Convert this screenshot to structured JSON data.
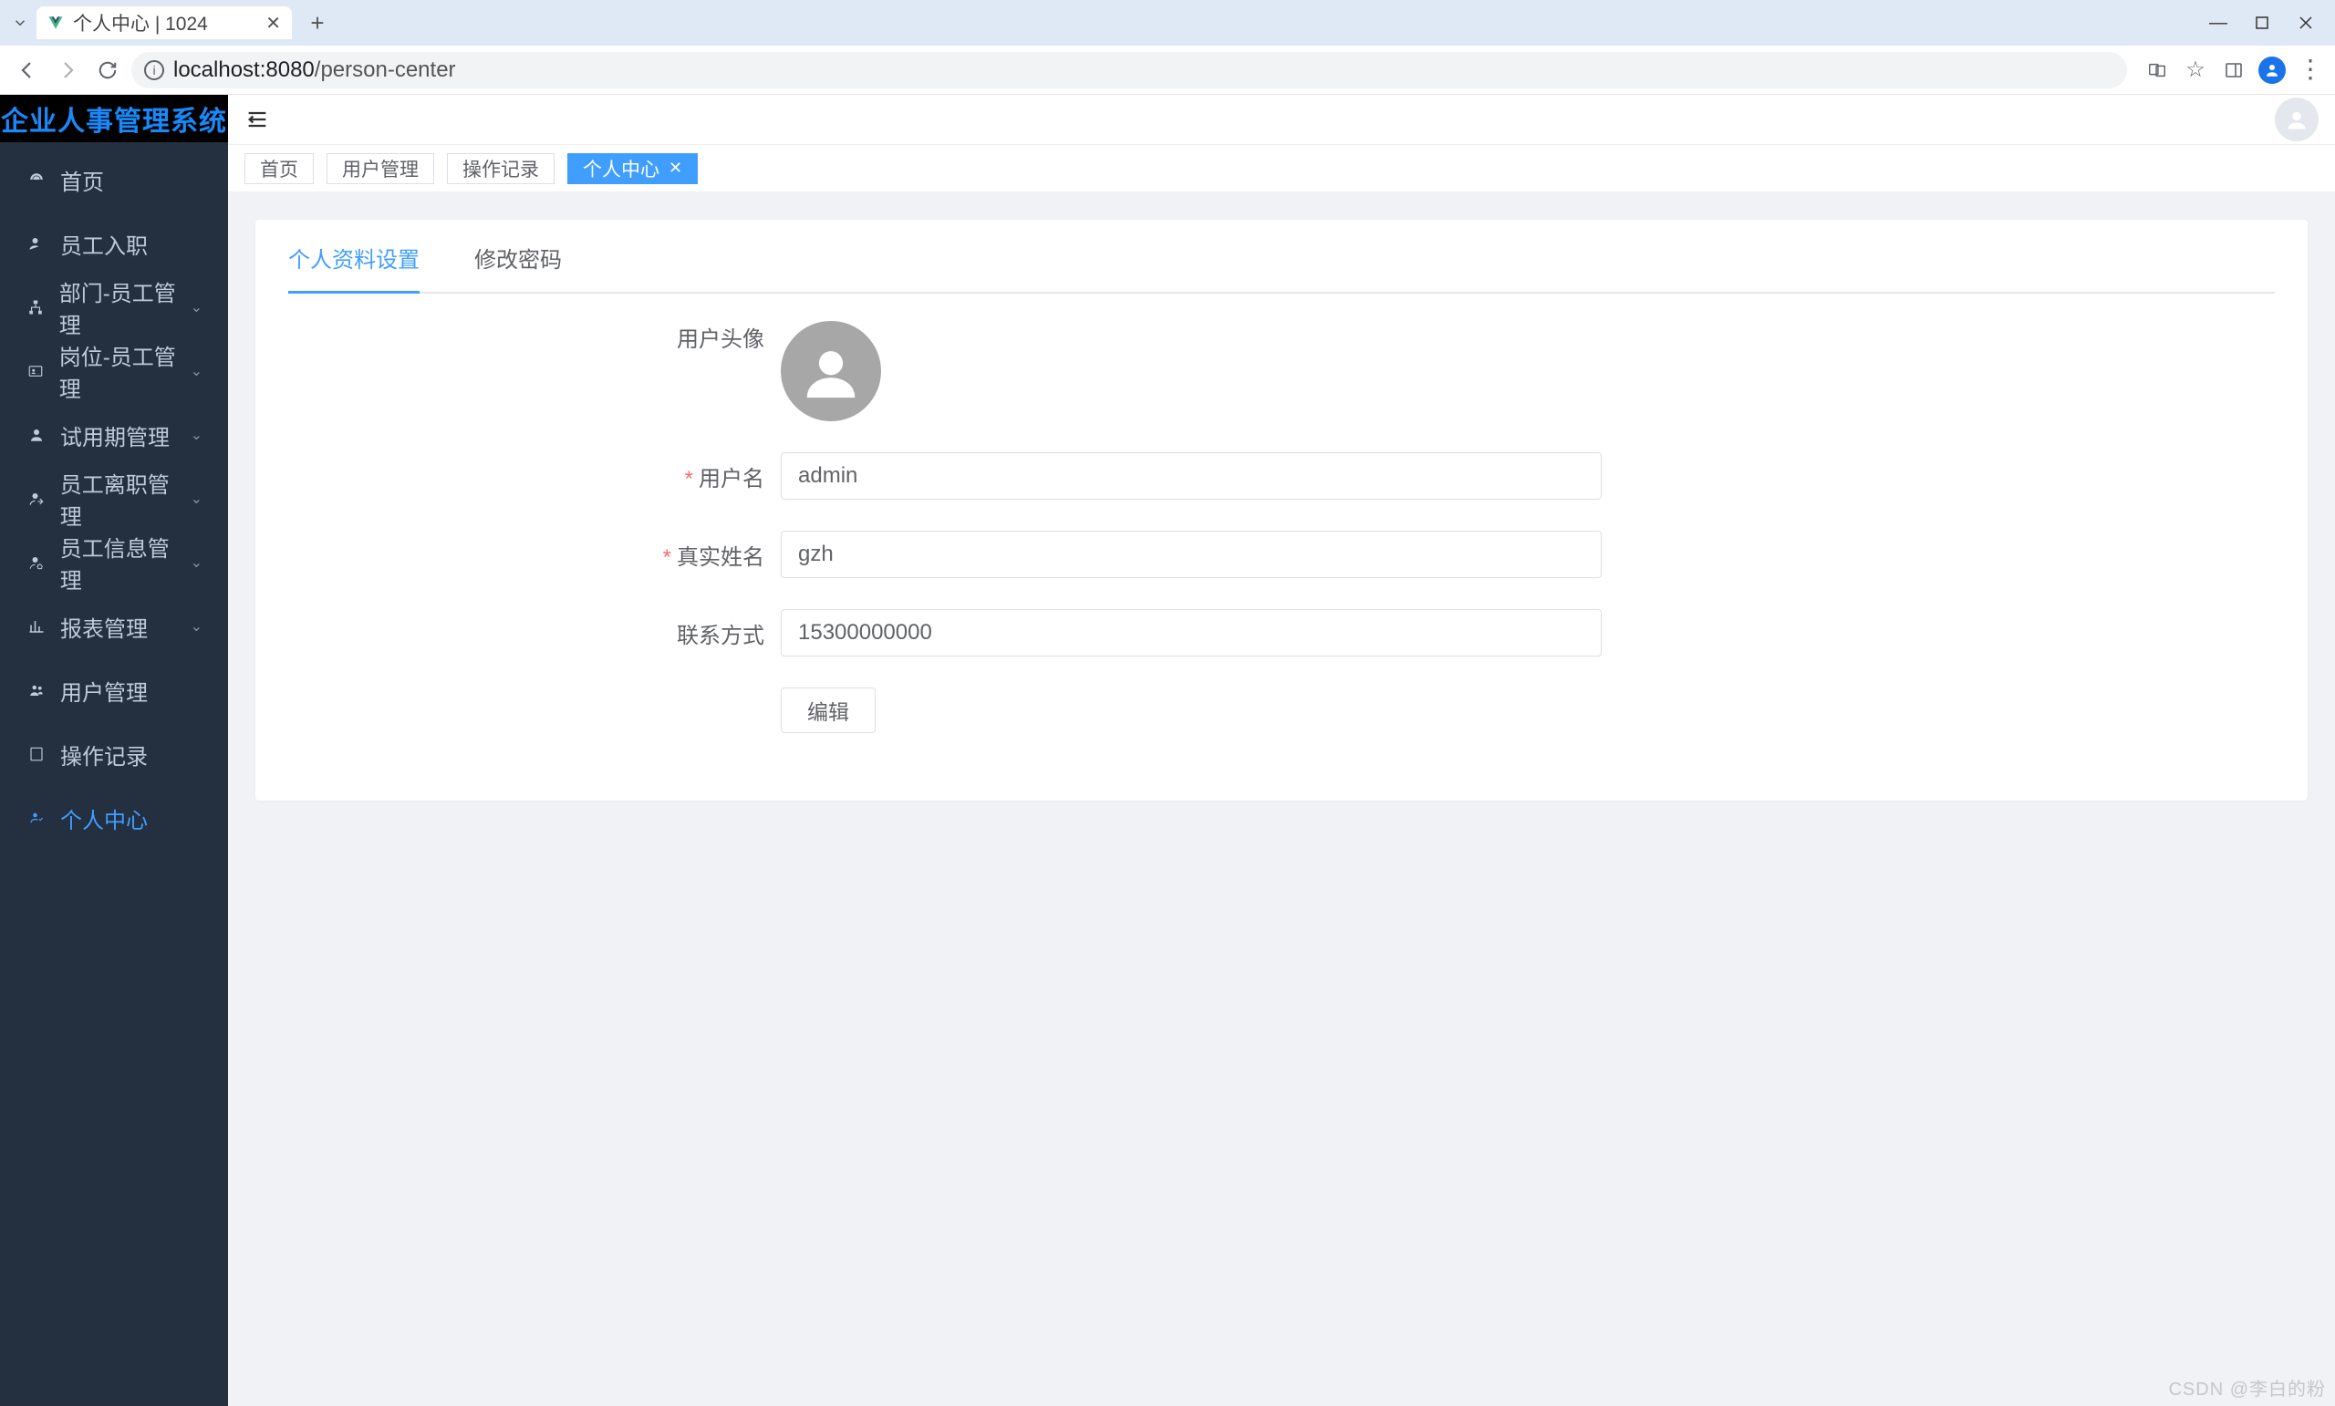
{
  "browser": {
    "tab_title": "个人中心 | 1024",
    "url_display_host": "localhost:",
    "url_display_port": "8080",
    "url_display_path": "/person-center"
  },
  "logo": "企业人事管理系统",
  "sidebar": {
    "items": [
      {
        "label": "首页",
        "expandable": false
      },
      {
        "label": "员工入职",
        "expandable": false
      },
      {
        "label": "部门-员工管理",
        "expandable": true
      },
      {
        "label": "岗位-员工管理",
        "expandable": true
      },
      {
        "label": "试用期管理",
        "expandable": true
      },
      {
        "label": "员工离职管理",
        "expandable": true
      },
      {
        "label": "员工信息管理",
        "expandable": true
      },
      {
        "label": "报表管理",
        "expandable": true
      },
      {
        "label": "用户管理",
        "expandable": false
      },
      {
        "label": "操作记录",
        "expandable": false
      },
      {
        "label": "个人中心",
        "expandable": false,
        "active": true
      }
    ]
  },
  "tagbar": {
    "tags": [
      {
        "label": "首页",
        "closable": false
      },
      {
        "label": "用户管理",
        "closable": false
      },
      {
        "label": "操作记录",
        "closable": false
      },
      {
        "label": "个人中心",
        "closable": true,
        "active": true
      }
    ]
  },
  "content_tabs": {
    "items": [
      {
        "label": "个人资料设置",
        "active": true
      },
      {
        "label": "修改密码",
        "active": false
      }
    ]
  },
  "form": {
    "avatar_label": "用户头像",
    "username_label": "用户名",
    "username_value": "admin",
    "realname_label": "真实姓名",
    "realname_value": "gzh",
    "contact_label": "联系方式",
    "contact_value": "15300000000",
    "edit_button": "编辑"
  },
  "watermark": "CSDN @李白的粉"
}
